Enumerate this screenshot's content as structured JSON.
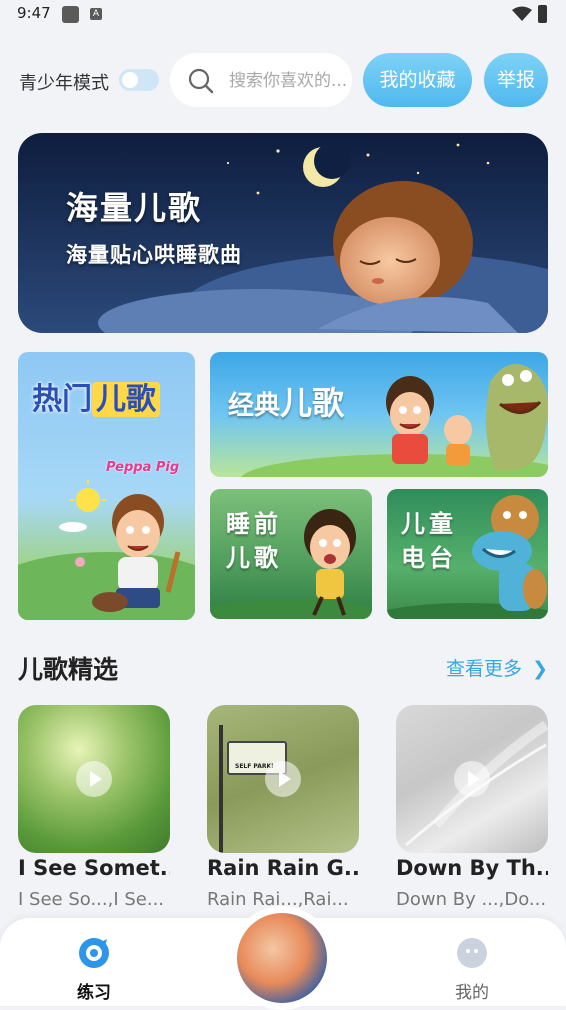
{
  "status_bar": {
    "time": "9:47",
    "a_icon_text": "A"
  },
  "top": {
    "teen_mode_label": "青少年模式",
    "search_placeholder": "搜索你喜欢的...",
    "favorites_label": "我的收藏",
    "report_label": "举报"
  },
  "banner": {
    "title": "海量儿歌",
    "subtitle": "海量贴心哄睡歌曲"
  },
  "tiles": {
    "hot": {
      "part1": "热门",
      "part2": "儿歌",
      "brand": "Peppa Pig"
    },
    "classic": {
      "part1": "经典",
      "part2": "儿歌"
    },
    "bedtime": {
      "label": "睡前儿歌"
    },
    "radio": {
      "label": "儿童电台"
    }
  },
  "section": {
    "title": "儿歌精选",
    "see_more": "查看更多"
  },
  "songs": [
    {
      "title": "I See Somet...",
      "subtitle": "I See So...,I Se..."
    },
    {
      "title": "Rain Rain G...",
      "subtitle": "Rain Rai...,Rai...",
      "sign_text": "SELF PARKI"
    },
    {
      "title": "Down By Th...",
      "subtitle": "Down By ...,Do..."
    }
  ],
  "bottom_nav": {
    "practice_label": "练习",
    "mine_label": "我的"
  },
  "colors": {
    "accent": "#4fb8ee",
    "link": "#3aa6e0",
    "background": "#f2f3f7"
  }
}
